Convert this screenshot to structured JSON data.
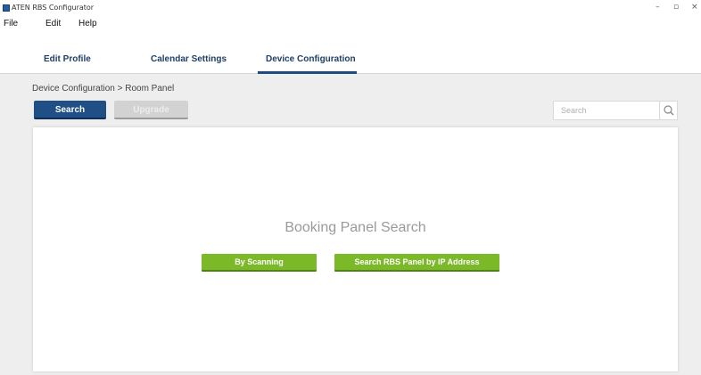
{
  "window": {
    "title": "ATEN RBS Configurator",
    "controls": {
      "minimize": "–",
      "maximize": "▫",
      "close": "×"
    }
  },
  "menu": {
    "items": [
      "File",
      "Edit",
      "Help"
    ]
  },
  "tabs": [
    {
      "label": "Edit Profile"
    },
    {
      "label": "Calendar Settings"
    },
    {
      "label": "Device Configuration",
      "active": true
    }
  ],
  "breadcrumb": "Device Configuration > Room Panel",
  "toolbar": {
    "search_label": "Search",
    "upgrade_label": "Upgrade"
  },
  "search": {
    "placeholder": "Search",
    "value": ""
  },
  "panel": {
    "title": "Booking Panel Search",
    "scan_label": "By Scanning",
    "ip_label": "Search RBS Panel by IP Address"
  },
  "colors": {
    "accent": "#1f4f84",
    "green": "#7cb929",
    "disabled": "#d2d2d2"
  },
  "icons": {
    "app": "app-icon",
    "search": "search-icon"
  }
}
